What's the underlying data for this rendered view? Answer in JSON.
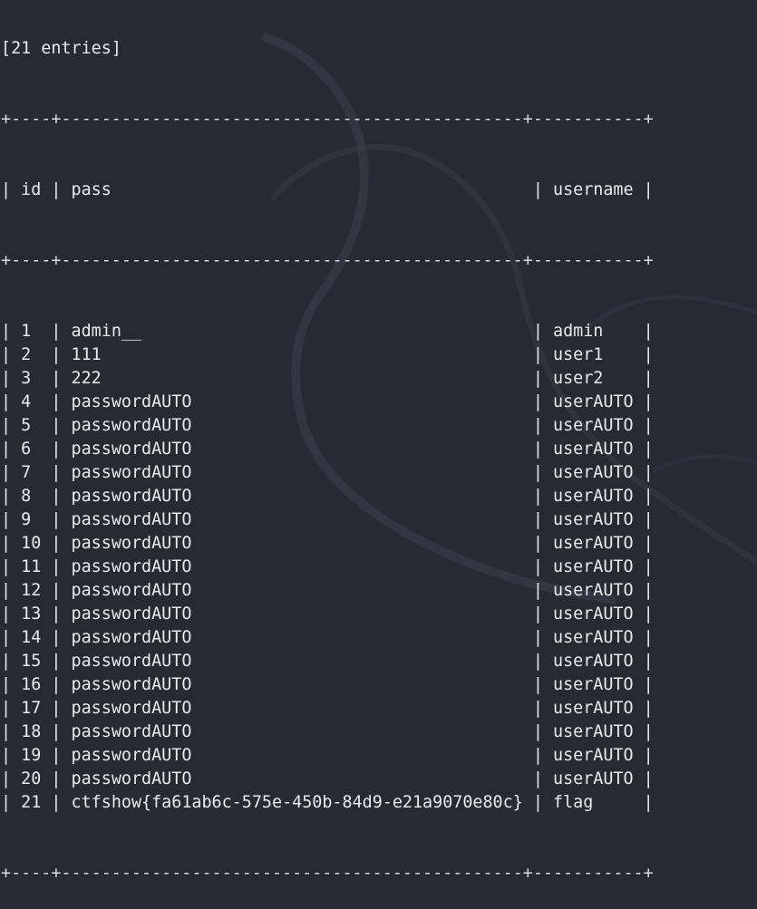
{
  "terminal": {
    "summary": "[21 entries]",
    "border": "+----+----------------------------------------------+-----------+",
    "columns": {
      "id": "id",
      "pass": "pass",
      "username": "username"
    },
    "rows": [
      {
        "id": "1",
        "pass": "admin__",
        "username": "admin"
      },
      {
        "id": "2",
        "pass": "111",
        "username": "user1"
      },
      {
        "id": "3",
        "pass": "222",
        "username": "user2"
      },
      {
        "id": "4",
        "pass": "passwordAUTO",
        "username": "userAUTO"
      },
      {
        "id": "5",
        "pass": "passwordAUTO",
        "username": "userAUTO"
      },
      {
        "id": "6",
        "pass": "passwordAUTO",
        "username": "userAUTO"
      },
      {
        "id": "7",
        "pass": "passwordAUTO",
        "username": "userAUTO"
      },
      {
        "id": "8",
        "pass": "passwordAUTO",
        "username": "userAUTO"
      },
      {
        "id": "9",
        "pass": "passwordAUTO",
        "username": "userAUTO"
      },
      {
        "id": "10",
        "pass": "passwordAUTO",
        "username": "userAUTO"
      },
      {
        "id": "11",
        "pass": "passwordAUTO",
        "username": "userAUTO"
      },
      {
        "id": "12",
        "pass": "passwordAUTO",
        "username": "userAUTO"
      },
      {
        "id": "13",
        "pass": "passwordAUTO",
        "username": "userAUTO"
      },
      {
        "id": "14",
        "pass": "passwordAUTO",
        "username": "userAUTO"
      },
      {
        "id": "15",
        "pass": "passwordAUTO",
        "username": "userAUTO"
      },
      {
        "id": "16",
        "pass": "passwordAUTO",
        "username": "userAUTO"
      },
      {
        "id": "17",
        "pass": "passwordAUTO",
        "username": "userAUTO"
      },
      {
        "id": "18",
        "pass": "passwordAUTO",
        "username": "userAUTO"
      },
      {
        "id": "19",
        "pass": "passwordAUTO",
        "username": "userAUTO"
      },
      {
        "id": "20",
        "pass": "passwordAUTO",
        "username": "userAUTO"
      },
      {
        "id": "21",
        "pass": "ctfshow{fa61ab6c-575e-450b-84d9-e21a9070e80c}",
        "username": "flag"
      }
    ]
  },
  "colors": {
    "background": "#262a33",
    "text": "#e8eaee"
  }
}
